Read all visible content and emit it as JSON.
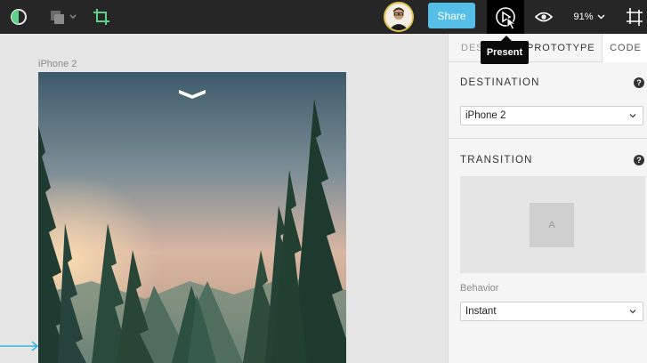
{
  "toolbar": {
    "share_label": "Share",
    "zoom_label": "91%",
    "present_tooltip": "Present",
    "icons": [
      "theme-toggle-icon",
      "shapes-icon",
      "crop-icon",
      "avatar",
      "present-icon",
      "eye-icon",
      "artboard-icon"
    ]
  },
  "canvas": {
    "artboard_name": "iPhone 2"
  },
  "panel": {
    "tabs": [
      {
        "label": "DESIGN"
      },
      {
        "label": "PROTOTYPE"
      },
      {
        "label": "CODE"
      }
    ],
    "destination": {
      "title": "DESTINATION",
      "value": "iPhone 2"
    },
    "transition": {
      "title": "TRANSITION",
      "state_label": "A"
    },
    "behavior": {
      "label": "Behavior",
      "value": "Instant"
    },
    "help_glyph": "?"
  },
  "colors": {
    "toolbar_bg": "#262626",
    "share_button": "#56bfe8",
    "link_arrow": "#37b4de",
    "avatar_ring": "#e3c24e"
  }
}
